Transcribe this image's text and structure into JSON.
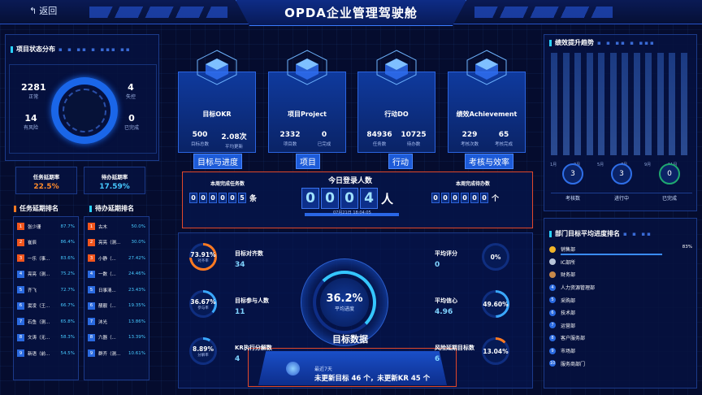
{
  "header": {
    "back": "返回",
    "title": "OPDA企业管理驾驶舱"
  },
  "left": {
    "status_title": "项目状态分布",
    "stats": [
      {
        "v": "2281",
        "l": "正常"
      },
      {
        "v": "14",
        "l": "有风险"
      },
      {
        "v": "4",
        "l": "失控"
      },
      {
        "v": "0",
        "l": "已完成"
      }
    ],
    "rates": [
      {
        "l": "任务延期率",
        "v": "22.5%",
        "color": "#ff8a2a"
      },
      {
        "l": "待办延期率",
        "v": "17.59%",
        "color": "#46c8ff"
      }
    ],
    "task_rank_title": "任务延期排名",
    "todo_rank_title": "待办延期排名",
    "task_rank": [
      {
        "n": "1",
        "name": "张少珊",
        "v": "87.7%"
      },
      {
        "n": "2",
        "name": "崔辰",
        "v": "86.4%"
      },
      {
        "n": "3",
        "name": "一乐（事...",
        "v": "83.6%"
      },
      {
        "n": "4",
        "name": "亮亮（测...",
        "v": "75.2%"
      },
      {
        "n": "5",
        "name": "齐飞",
        "v": "72.7%"
      },
      {
        "n": "6",
        "name": "窦凌（王...",
        "v": "66.7%"
      },
      {
        "n": "7",
        "name": "石鱼（测...",
        "v": "65.8%"
      },
      {
        "n": "8",
        "name": "文涛（无...",
        "v": "58.3%"
      },
      {
        "n": "9",
        "name": "新语（前...",
        "v": "54.5%"
      }
    ],
    "todo_rank": [
      {
        "n": "1",
        "name": "古木",
        "v": "50.0%"
      },
      {
        "n": "2",
        "name": "亮亮（测...",
        "v": "30.0%"
      },
      {
        "n": "3",
        "name": "小静（...",
        "v": "27.42%"
      },
      {
        "n": "4",
        "name": "一数（...",
        "v": "24.46%"
      },
      {
        "n": "5",
        "name": "日事清...",
        "v": "23.43%"
      },
      {
        "n": "6",
        "name": "靓靓（...",
        "v": "19.35%"
      },
      {
        "n": "7",
        "name": "沐光",
        "v": "13.86%"
      },
      {
        "n": "8",
        "name": "六器（...",
        "v": "13.39%"
      },
      {
        "n": "9",
        "name": "群齐（测...",
        "v": "10.61%"
      }
    ]
  },
  "cards": [
    {
      "name": "目标OKR",
      "tag": "目标与进度",
      "s1v": "500",
      "s1l": "目标总数",
      "s2v": "2.08次",
      "s2l": "平均更新"
    },
    {
      "name": "项目Project",
      "tag": "项目",
      "s1v": "2332",
      "s1l": "项目数",
      "s2v": "0",
      "s2l": "已完成"
    },
    {
      "name": "行动DO",
      "tag": "行动",
      "s1v": "84936",
      "s1l": "任务数",
      "s2v": "10725",
      "s2l": "待办数"
    },
    {
      "name": "绩效Achievement",
      "tag": "考核与效率",
      "s1v": "229",
      "s1l": "考核次数",
      "s2v": "65",
      "s2l": "考核完成"
    }
  ],
  "login": {
    "week_task_label": "本周完成任务数",
    "week_task_digits": [
      "0",
      "0",
      "0",
      "0",
      "0",
      "5"
    ],
    "week_task_unit": "条",
    "today_label": "今日登录人数",
    "today_digits": [
      "0",
      "0",
      "0",
      "4"
    ],
    "today_unit": "人",
    "date": "07月21日 18:04:05",
    "week_todo_label": "本周完成待办数",
    "week_todo_digits": [
      "0",
      "0",
      "0",
      "0",
      "0",
      "0"
    ],
    "week_todo_unit": "个"
  },
  "goals": {
    "center_pct": "36.2%",
    "center_sub": "平均进度",
    "center_title": "目标数据",
    "left": [
      {
        "pct": "73.91%",
        "sub": "对齐率",
        "k": "目标对齐数",
        "v": "34",
        "frac": 0.7391
      },
      {
        "pct": "36.67%",
        "sub": "参与率",
        "k": "目标参与人数",
        "v": "11",
        "frac": 0.3667
      },
      {
        "pct": "8.89%",
        "sub": "分解率",
        "k": "KR执行分解数",
        "v": "4",
        "frac": 0.0889
      }
    ],
    "right": [
      {
        "k": "平均评分",
        "v": "0",
        "pct": "0%",
        "frac": 0
      },
      {
        "k": "平均信心",
        "v": "4.96",
        "pct": "49.60%",
        "frac": 0.496
      },
      {
        "k": "风险延期目标数",
        "v": "6",
        "pct": "13.04%",
        "frac": 0.1304
      }
    ],
    "recent_label": "最近7天",
    "recent_text": "未更新目标 46 个，未更新KR 45 个"
  },
  "right": {
    "trend_title": "绩效提升趋势",
    "months": [
      "1月",
      "3月",
      "5月",
      "7月",
      "9月",
      "11月"
    ],
    "circles": [
      {
        "v": "3",
        "l": "考核数"
      },
      {
        "v": "3",
        "l": "进行中"
      },
      {
        "v": "0",
        "l": "已完成"
      }
    ],
    "dept_title": "部门目标平均进度排名",
    "depts": [
      {
        "name": "销售部",
        "v": "83%",
        "frac": 0.83
      },
      {
        "name": "IC部所",
        "frac": 0
      },
      {
        "name": "财务部",
        "frac": 0
      },
      {
        "name": "人力资源管理部",
        "frac": 0
      },
      {
        "name": "采购部",
        "frac": 0
      },
      {
        "name": "技术部",
        "frac": 0
      },
      {
        "name": "运营部",
        "frac": 0
      },
      {
        "name": "客户服务部",
        "frac": 0
      },
      {
        "name": "市场部",
        "frac": 0
      },
      {
        "name": "服务商部门",
        "frac": 0
      }
    ]
  },
  "colors": {
    "accent": "#2ad2ff",
    "orange": "#ff7a22",
    "panel": "#061240",
    "border": "#1b3a8a"
  }
}
